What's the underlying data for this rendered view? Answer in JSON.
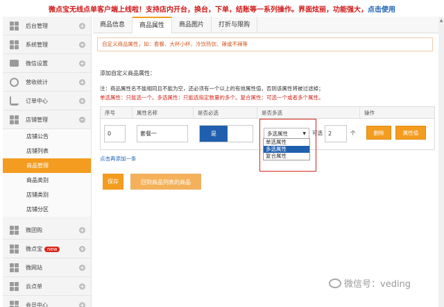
{
  "banner": {
    "part1": "微点宝无线点单客户端上线啦！支持店内开台，换台，下单，结账等一系列操作。界面炫丽，功能强大，",
    "link": "点击使用"
  },
  "sidebar": {
    "items": [
      {
        "label": "后台管理"
      },
      {
        "label": "系统管理"
      },
      {
        "label": "微信设置"
      },
      {
        "label": "营收统计"
      },
      {
        "label": "订单中心"
      },
      {
        "label": "店铺管理"
      }
    ],
    "subitems": [
      {
        "label": "店铺公告"
      },
      {
        "label": "店铺列表"
      },
      {
        "label": "商品管理"
      },
      {
        "label": "商品类别"
      },
      {
        "label": "店铺类别"
      },
      {
        "label": "店铺分区"
      }
    ],
    "lower_items": [
      {
        "label": "微团购"
      },
      {
        "label": "微点宝",
        "badge": "new"
      },
      {
        "label": "微网站"
      },
      {
        "label": "云点单"
      },
      {
        "label": "会员中心"
      }
    ]
  },
  "tabs": [
    {
      "label": "商品信息"
    },
    {
      "label": "商品属性"
    },
    {
      "label": "商品图片"
    },
    {
      "label": "打折与限购"
    }
  ],
  "tip": "自定义商品属性，如：套餐、大杯小杯、冷饮热饮、辣或不辣等",
  "section_title": "添加自定义商品属性：",
  "note1": "注：商品属性名不能相同且不能为空，还必须有一个以上的有效属性值，否则该属性将被过滤掉；",
  "note2": "单选属性：只能选一个。多选属性：只能选指定数量的多个。复合属性：可选一个或者多个属性。",
  "table": {
    "headers": [
      "序号",
      "属性名称",
      "是否必选",
      "是否多选",
      "操作"
    ],
    "row": {
      "index": "0",
      "name": "套餐一",
      "required_label": "是",
      "multi_selected": "多选属性",
      "optional_label": "可选",
      "count": "2",
      "unit": "个",
      "delete_label": "删除",
      "attr_value_label": "属性值"
    },
    "dropdown_options": [
      "单选属性",
      "多选属性",
      "复合属性"
    ]
  },
  "add_link": "点击再添加一条",
  "buttons": {
    "save": "保存",
    "back": "回到商品列表的商品"
  },
  "watermark": "微信号：veding"
}
